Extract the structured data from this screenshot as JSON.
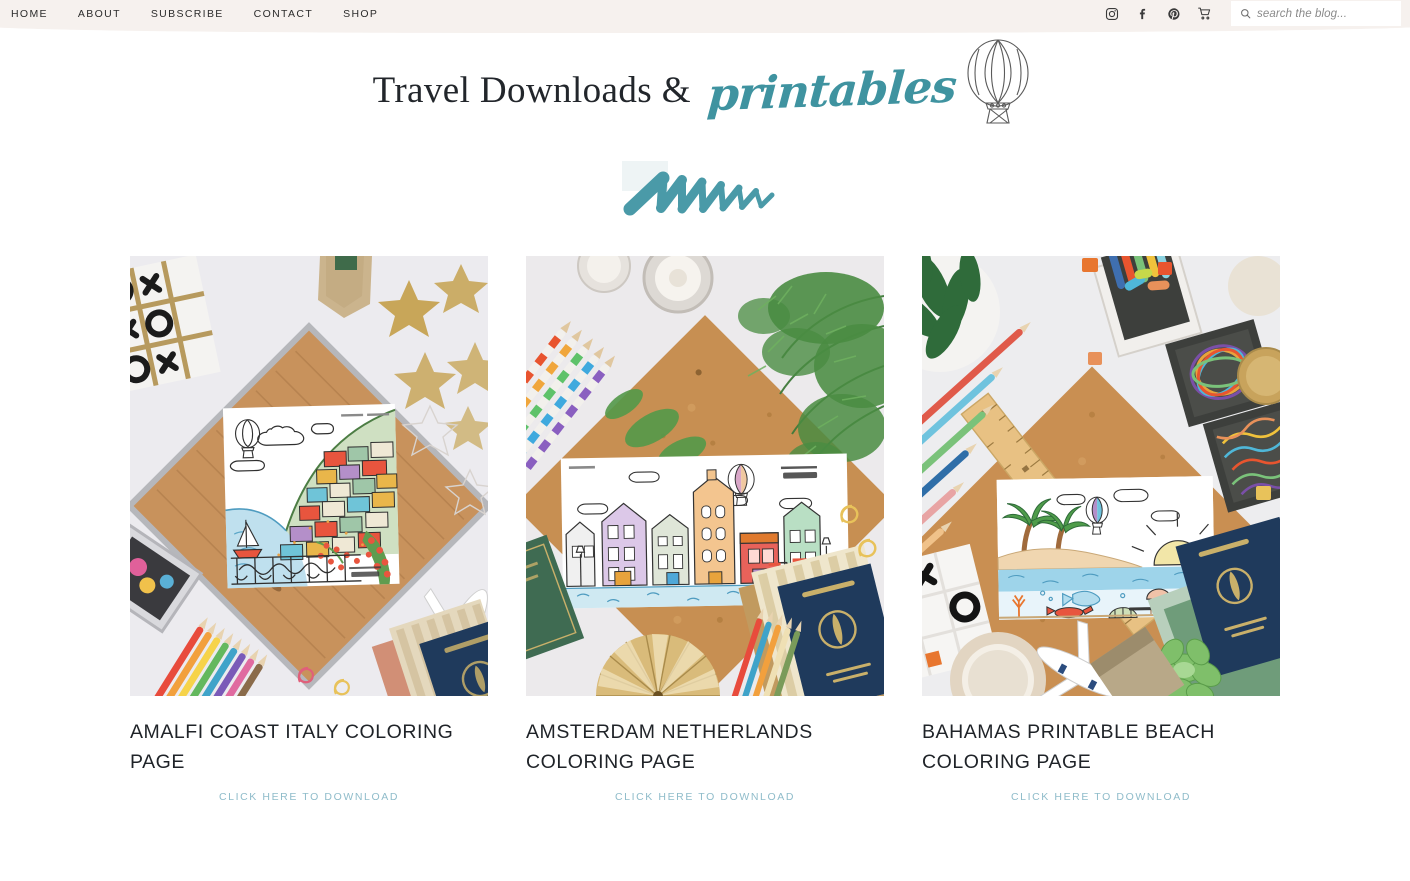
{
  "nav": {
    "items": [
      {
        "label": "HOME",
        "name": "nav-home"
      },
      {
        "label": "ABOUT",
        "name": "nav-about"
      },
      {
        "label": "SUBSCRIBE",
        "name": "nav-subscribe"
      },
      {
        "label": "CONTACT",
        "name": "nav-contact"
      },
      {
        "label": "SHOP",
        "name": "nav-shop"
      }
    ]
  },
  "socials": [
    {
      "icon": "instagram-icon"
    },
    {
      "icon": "facebook-icon"
    },
    {
      "icon": "pinterest-icon"
    },
    {
      "icon": "shopping-cart-icon"
    }
  ],
  "search": {
    "icon": "search-icon",
    "placeholder": "search the blog...",
    "value": ""
  },
  "header": {
    "title_serif": "Travel Downloads &",
    "title_script": "printables",
    "balloon_icon": "hot-air-balloon-icon",
    "divider_icon": "teal-brush-squiggle-divider"
  },
  "colors": {
    "header_bg": "#f6f1ee",
    "accent_teal": "#3f93a0",
    "link_teal": "#8fbcca",
    "text_dark": "#1f2328"
  },
  "cards": [
    {
      "name": "card-amalfi-coast-italy",
      "title": "Amalfi Coast Italy Coloring Page",
      "link_label": "Click Here to Download",
      "photo_alt": "flat lay of wooden board with amalfi coast coloring page, tic tac toe board, gold stars, colored pencils, passports and toy airplane"
    },
    {
      "name": "card-amsterdam-netherlands",
      "title": "Amsterdam Netherlands Coloring Page",
      "link_label": "Click Here to Download",
      "photo_alt": "flat lay of cork board with amsterdam canal houses coloring page, pine greenery, striped pencils, gold paper fan and passport"
    },
    {
      "name": "card-bahamas-printable-beach",
      "title": "Bahamas Printable Beach Coloring Page",
      "link_label": "Click Here to Download",
      "photo_alt": "flat lay of cork board with bahamas beach coloring page, wooden ruler, succulent, paper clips, toy airplane and passport"
    }
  ]
}
